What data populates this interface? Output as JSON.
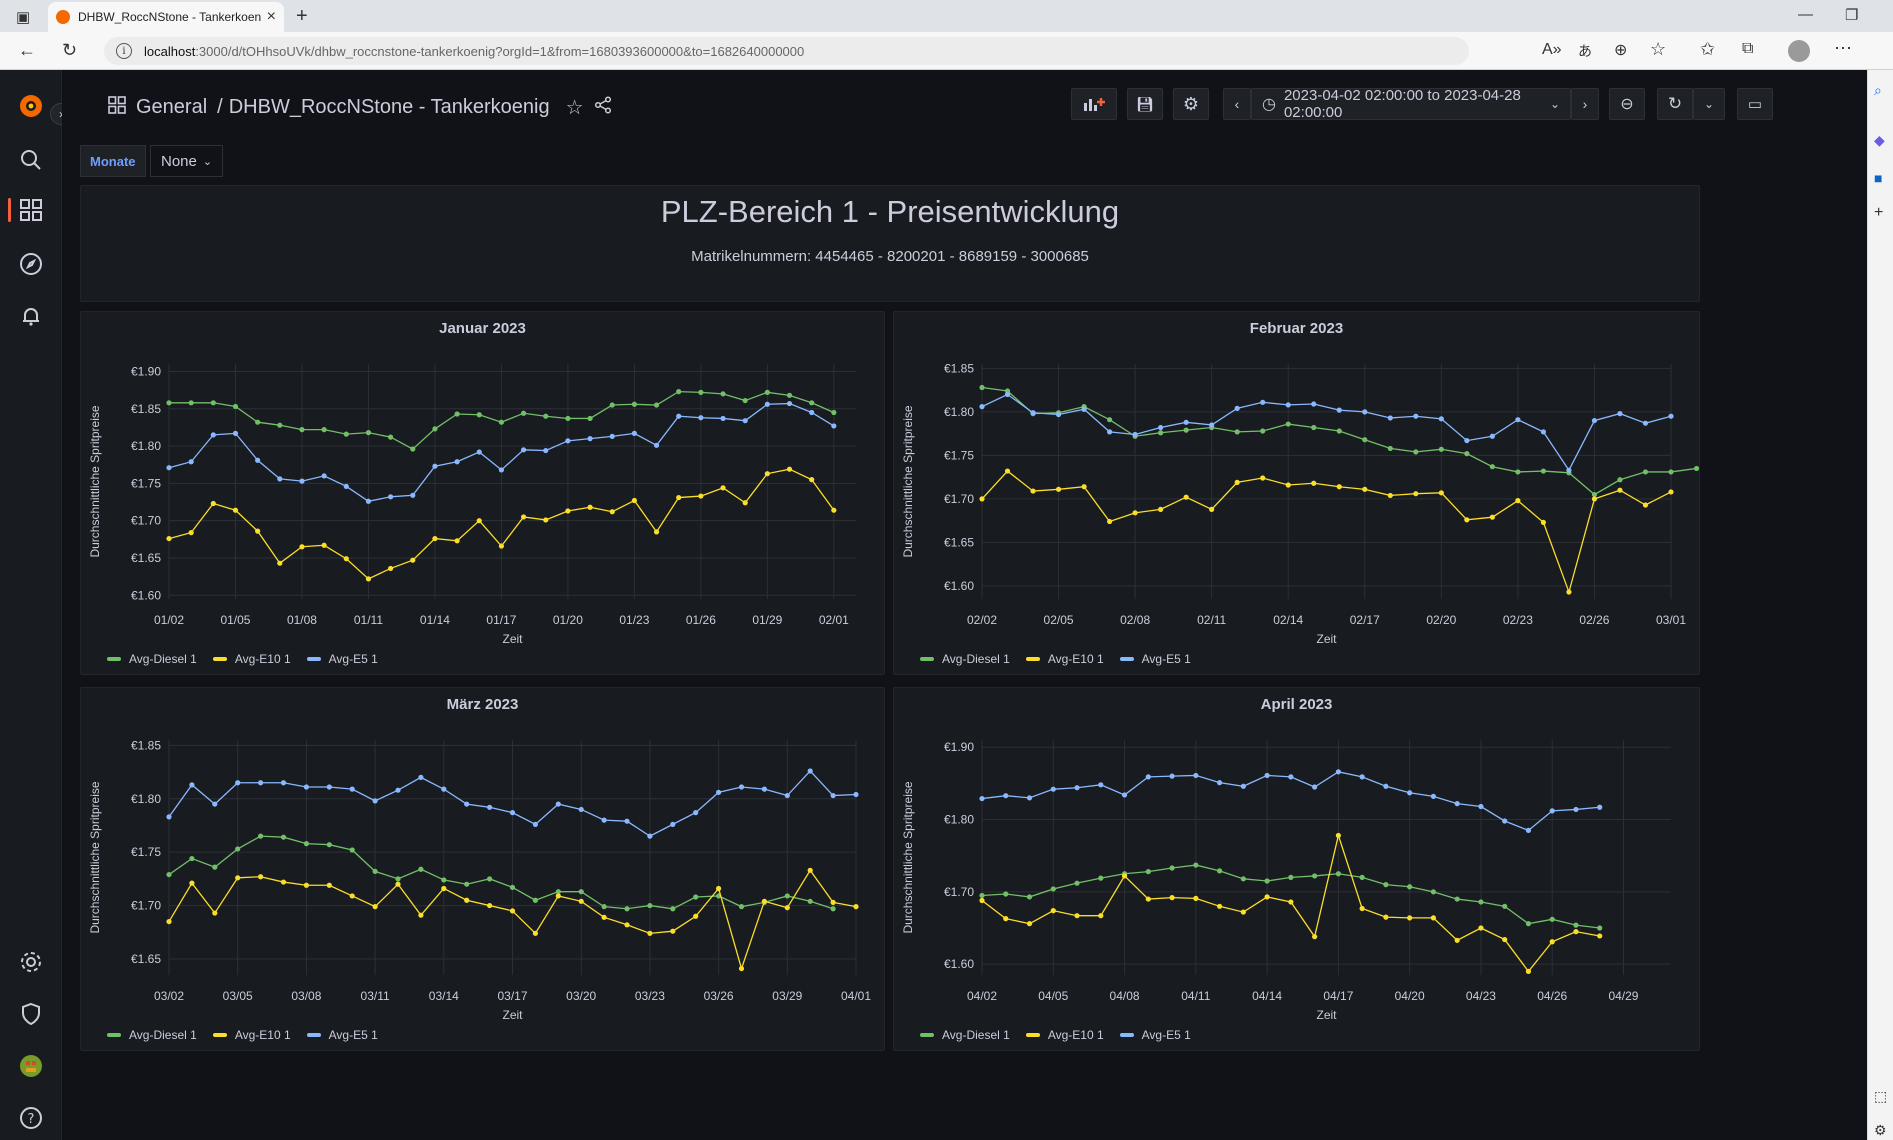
{
  "browser": {
    "tab_title": "DHBW_RoccNStone - Tankerkoen",
    "url_host": "localhost",
    "url_rest": ":3000/d/tOHhsoUVk/dhbw_roccnstone-tankerkoenig?orgId=1&from=1680393600000&to=1682640000000"
  },
  "topbar": {
    "folder": "General",
    "separator": "/",
    "dashboard_title": "DHBW_RoccNStone - Tankerkoenig",
    "time_range": "2023-04-02 02:00:00 to 2023-04-28 02:00:00"
  },
  "variables": {
    "label": "Monate",
    "value": "None"
  },
  "header_panel": {
    "title": "PLZ-Bereich 1 - Preisentwicklung",
    "subtitle": "Matrikelnummern: 4454465 - 8200201 - 8689159 - 3000685"
  },
  "colors": {
    "diesel": "#73bf69",
    "e10": "#fade2a",
    "e5": "#8ab8ff"
  },
  "chart_data": [
    {
      "type": "line",
      "title": "Januar 2023",
      "xlabel": "Zeit",
      "ylabel": "Durchschnittliche Spritpreise",
      "ylim": [
        1.595,
        1.91
      ],
      "yticks": [
        1.6,
        1.65,
        1.7,
        1.75,
        1.8,
        1.85,
        1.9
      ],
      "ytick_labels": [
        "€1.60",
        "€1.65",
        "€1.70",
        "€1.75",
        "€1.80",
        "€1.85",
        "€1.90"
      ],
      "xmax": 31,
      "xticks": [
        0,
        3,
        6,
        9,
        12,
        15,
        18,
        21,
        24,
        27,
        30
      ],
      "xtick_labels": [
        "01/02",
        "01/05",
        "01/08",
        "01/11",
        "01/14",
        "01/17",
        "01/20",
        "01/23",
        "01/26",
        "01/29",
        "02/01"
      ],
      "legend": [
        "Avg-Diesel 1",
        "Avg-E10 1",
        "Avg-E5 1"
      ],
      "series": [
        {
          "name": "Avg-Diesel 1",
          "x_start": 0,
          "values": [
            1.858,
            1.858,
            1.858,
            1.853,
            1.832,
            1.828,
            1.822,
            1.822,
            1.816,
            1.818,
            1.812,
            1.796,
            1.823,
            1.843,
            1.842,
            1.832,
            1.844,
            1.84,
            1.837,
            1.837,
            1.855,
            1.856,
            1.855,
            1.873,
            1.872,
            1.87,
            1.861,
            1.872,
            1.868,
            1.858,
            1.845
          ]
        },
        {
          "name": "Avg-E10 1",
          "x_start": 0,
          "values": [
            1.676,
            1.684,
            1.723,
            1.714,
            1.686,
            1.643,
            1.665,
            1.667,
            1.649,
            1.622,
            1.636,
            1.647,
            1.676,
            1.673,
            1.7,
            1.666,
            1.705,
            1.701,
            1.713,
            1.718,
            1.712,
            1.727,
            1.685,
            1.731,
            1.733,
            1.744,
            1.724,
            1.763,
            1.769,
            1.755,
            1.714
          ]
        },
        {
          "name": "Avg-E5 1",
          "x_start": 0,
          "values": [
            1.771,
            1.779,
            1.815,
            1.817,
            1.781,
            1.756,
            1.753,
            1.76,
            1.746,
            1.726,
            1.732,
            1.734,
            1.773,
            1.779,
            1.792,
            1.768,
            1.795,
            1.794,
            1.807,
            1.81,
            1.813,
            1.817,
            1.801,
            1.84,
            1.838,
            1.837,
            1.834,
            1.856,
            1.857,
            1.845,
            1.827
          ]
        }
      ]
    },
    {
      "type": "line",
      "title": "Februar 2023",
      "xlabel": "Zeit",
      "ylabel": "Durchschnittliche Spritpreise",
      "ylim": [
        1.585,
        1.855
      ],
      "yticks": [
        1.6,
        1.65,
        1.7,
        1.75,
        1.8,
        1.85
      ],
      "ytick_labels": [
        "€1.60",
        "€1.65",
        "€1.70",
        "€1.75",
        "€1.80",
        "€1.85"
      ],
      "xmax": 27,
      "xticks": [
        0,
        3,
        6,
        9,
        12,
        15,
        18,
        21,
        24,
        27
      ],
      "xtick_labels": [
        "02/02",
        "02/05",
        "02/08",
        "02/11",
        "02/14",
        "02/17",
        "02/20",
        "02/23",
        "02/26",
        "03/01"
      ],
      "legend": [
        "Avg-Diesel 1",
        "Avg-E10 1",
        "Avg-E5 1"
      ],
      "series": [
        {
          "name": "Avg-Diesel 1",
          "x_start": 0,
          "values": [
            1.828,
            1.824,
            1.798,
            1.799,
            1.806,
            1.791,
            1.772,
            1.776,
            1.779,
            1.782,
            1.777,
            1.778,
            1.786,
            1.782,
            1.778,
            1.768,
            1.758,
            1.754,
            1.757,
            1.752,
            1.737,
            1.731,
            1.732,
            1.73,
            1.705,
            1.722,
            1.731,
            1.731,
            1.735
          ]
        },
        {
          "name": "Avg-E10 1",
          "x_start": 0,
          "values": [
            1.7,
            1.732,
            1.709,
            1.711,
            1.714,
            1.674,
            1.684,
            1.688,
            1.702,
            1.688,
            1.719,
            1.724,
            1.716,
            1.718,
            1.714,
            1.711,
            1.704,
            1.706,
            1.707,
            1.676,
            1.679,
            1.698,
            1.673,
            1.593,
            1.7,
            1.71,
            1.693,
            1.708
          ]
        },
        {
          "name": "Avg-E5 1",
          "x_start": 0,
          "values": [
            1.806,
            1.82,
            1.799,
            1.797,
            1.803,
            1.777,
            1.774,
            1.782,
            1.788,
            1.785,
            1.804,
            1.811,
            1.808,
            1.809,
            1.802,
            1.8,
            1.793,
            1.795,
            1.792,
            1.767,
            1.772,
            1.791,
            1.777,
            1.733,
            1.79,
            1.798,
            1.787,
            1.795
          ]
        }
      ]
    },
    {
      "type": "line",
      "title": "März 2023",
      "xlabel": "Zeit",
      "ylabel": "Durchschnittliche Spritpreise",
      "ylim": [
        1.635,
        1.855
      ],
      "yticks": [
        1.65,
        1.7,
        1.75,
        1.8,
        1.85
      ],
      "ytick_labels": [
        "€1.65",
        "€1.70",
        "€1.75",
        "€1.80",
        "€1.85"
      ],
      "xmax": 30,
      "xticks": [
        0,
        3,
        6,
        9,
        12,
        15,
        18,
        21,
        24,
        27,
        30
      ],
      "xtick_labels": [
        "03/02",
        "03/05",
        "03/08",
        "03/11",
        "03/14",
        "03/17",
        "03/20",
        "03/23",
        "03/26",
        "03/29",
        "04/01"
      ],
      "legend": [
        "Avg-Diesel 1",
        "Avg-E10 1",
        "Avg-E5 1"
      ],
      "series": [
        {
          "name": "Avg-Diesel 1",
          "x_start": 0,
          "values": [
            1.729,
            1.744,
            1.736,
            1.753,
            1.765,
            1.764,
            1.758,
            1.757,
            1.752,
            1.732,
            1.725,
            1.734,
            1.724,
            1.72,
            1.725,
            1.717,
            1.705,
            1.713,
            1.713,
            1.699,
            1.697,
            1.7,
            1.697,
            1.708,
            1.709,
            1.699,
            1.703,
            1.709,
            1.704,
            1.697
          ]
        },
        {
          "name": "Avg-E10 1",
          "x_start": 0,
          "values": [
            1.685,
            1.721,
            1.693,
            1.726,
            1.727,
            1.722,
            1.719,
            1.719,
            1.709,
            1.699,
            1.72,
            1.691,
            1.716,
            1.705,
            1.7,
            1.695,
            1.674,
            1.709,
            1.704,
            1.689,
            1.682,
            1.674,
            1.676,
            1.69,
            1.716,
            1.641,
            1.704,
            1.698,
            1.733,
            1.703,
            1.699
          ]
        },
        {
          "name": "Avg-E5 1",
          "x_start": 0,
          "values": [
            1.783,
            1.813,
            1.795,
            1.815,
            1.815,
            1.815,
            1.811,
            1.811,
            1.809,
            1.798,
            1.808,
            1.82,
            1.809,
            1.795,
            1.792,
            1.787,
            1.776,
            1.795,
            1.79,
            1.78,
            1.779,
            1.765,
            1.776,
            1.787,
            1.806,
            1.811,
            1.809,
            1.803,
            1.826,
            1.803,
            1.804
          ]
        }
      ]
    },
    {
      "type": "line",
      "title": "April 2023",
      "xlabel": "Zeit",
      "ylabel": "Durchschnittliche Spritpreise",
      "ylim": [
        1.585,
        1.91
      ],
      "yticks": [
        1.6,
        1.7,
        1.8,
        1.9
      ],
      "ytick_labels": [
        "€1.60",
        "€1.70",
        "€1.80",
        "€1.90"
      ],
      "xmax": 29,
      "xticks": [
        0,
        3,
        6,
        9,
        12,
        15,
        18,
        21,
        24,
        27
      ],
      "xtick_labels": [
        "04/02",
        "04/05",
        "04/08",
        "04/11",
        "04/14",
        "04/17",
        "04/20",
        "04/23",
        "04/26",
        "04/29"
      ],
      "legend": [
        "Avg-Diesel 1",
        "Avg-E10 1",
        "Avg-E5 1"
      ],
      "series": [
        {
          "name": "Avg-Diesel 1",
          "x_start": 0,
          "values": [
            1.695,
            1.697,
            1.693,
            1.704,
            1.712,
            1.719,
            1.725,
            1.728,
            1.733,
            1.737,
            1.729,
            1.718,
            1.715,
            1.72,
            1.722,
            1.725,
            1.72,
            1.71,
            1.707,
            1.7,
            1.69,
            1.686,
            1.68,
            1.656,
            1.662,
            1.654,
            1.65
          ]
        },
        {
          "name": "Avg-E10 1",
          "x_start": 0,
          "values": [
            1.688,
            1.663,
            1.656,
            1.674,
            1.667,
            1.667,
            1.722,
            1.69,
            1.692,
            1.691,
            1.68,
            1.672,
            1.693,
            1.686,
            1.638,
            1.778,
            1.677,
            1.665,
            1.664,
            1.664,
            1.633,
            1.65,
            1.634,
            1.59,
            1.631,
            1.645,
            1.639
          ]
        },
        {
          "name": "Avg-E5 1",
          "x_start": 0,
          "values": [
            1.829,
            1.833,
            1.83,
            1.842,
            1.844,
            1.848,
            1.834,
            1.859,
            1.86,
            1.861,
            1.851,
            1.846,
            1.861,
            1.859,
            1.845,
            1.866,
            1.859,
            1.846,
            1.837,
            1.832,
            1.822,
            1.818,
            1.798,
            1.785,
            1.812,
            1.814,
            1.817
          ]
        }
      ]
    }
  ]
}
